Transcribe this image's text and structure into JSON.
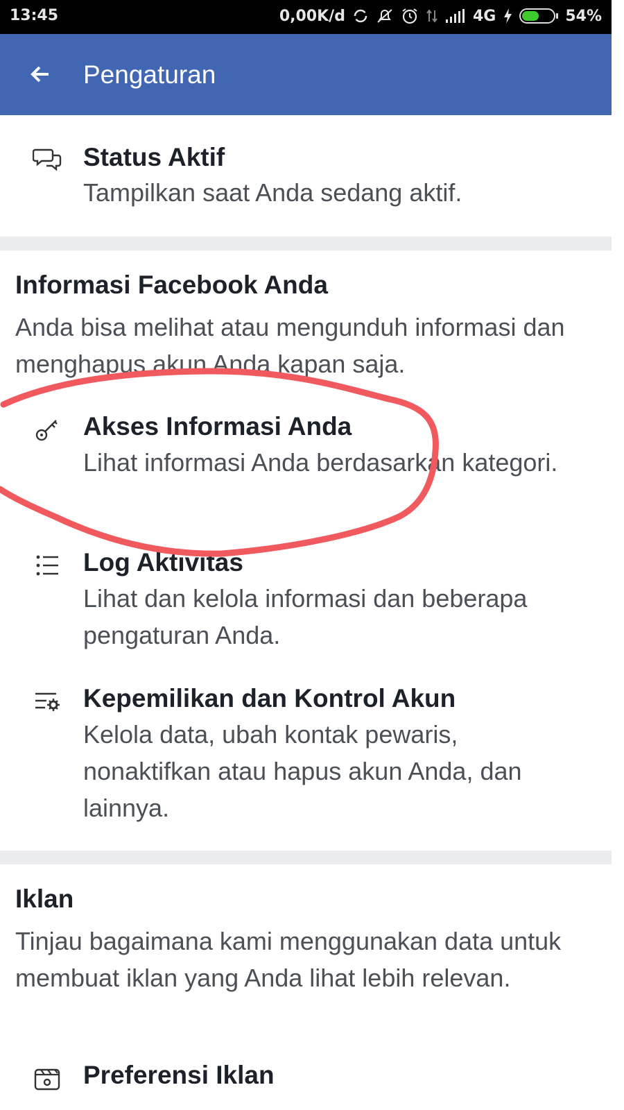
{
  "status_bar": {
    "time": "13:45",
    "net_speed": "0,00K/d",
    "network": "4G",
    "battery_percent": "54%",
    "battery_level": 0.54
  },
  "app_bar": {
    "back_icon": "arrow-left-icon",
    "title": "Pengaturan"
  },
  "active_status": {
    "icon": "chat-bubbles-icon",
    "title": "Status Aktif",
    "description": "Tampilkan saat Anda sedang aktif."
  },
  "facebook_info": {
    "title": "Informasi Facebook Anda",
    "description": "Anda bisa melihat atau mengunduh informasi dan menghapus akun Anda kapan saja.",
    "items": [
      {
        "icon": "key-icon",
        "title": "Akses Informasi Anda",
        "description": "Lihat informasi Anda berdasarkan kategori."
      },
      {
        "icon": "list-icon",
        "title": "Log Aktivitas",
        "description": "Lihat dan kelola informasi dan beberapa pengaturan Anda."
      },
      {
        "icon": "list-gear-icon",
        "title": "Kepemilikan dan Kontrol Akun",
        "description": "Kelola data, ubah kontak pewaris, nonaktifkan atau hapus akun Anda, dan lainnya."
      }
    ]
  },
  "ads": {
    "title": "Iklan",
    "description": "Tinjau bagaimana kami menggunakan data untuk membuat iklan yang Anda lihat lebih relevan.",
    "items": [
      {
        "icon": "ad-preferences-icon",
        "title": "Preferensi Iklan"
      }
    ]
  },
  "annotation": {
    "shape": "hand-drawn circle",
    "color": "#f05a5f",
    "target": "Akses Informasi Anda"
  },
  "colors": {
    "app_bar": "#4267b2",
    "section_divider": "#e9ebee",
    "battery": "#3ecb2d"
  }
}
